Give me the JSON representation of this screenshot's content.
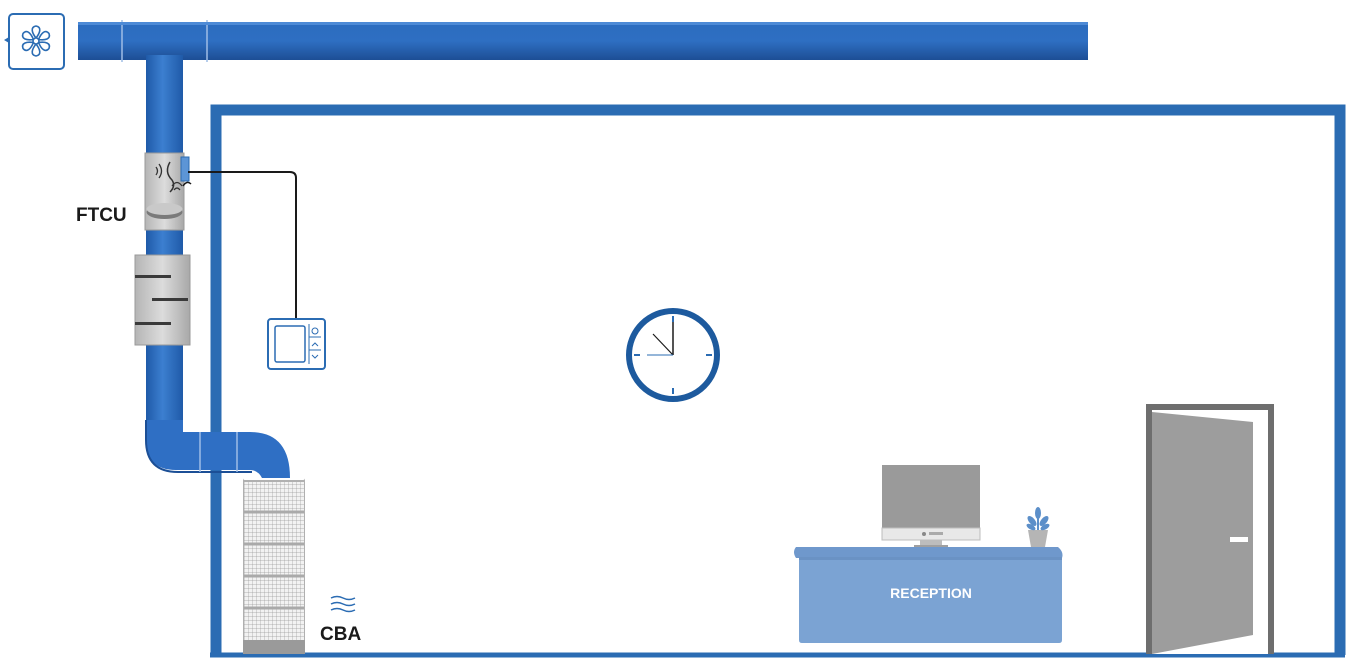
{
  "labels": {
    "ftcu": "FTCU",
    "cba": "CBA",
    "reception": "RECEPTION"
  },
  "icons": {
    "fan": "fan-icon",
    "clock": "clock-icon",
    "thermostat": "thermostat-icon",
    "airflow": "airflow-icon",
    "plant": "plant-icon",
    "monitor": "monitor-icon",
    "door": "door-icon"
  },
  "colors": {
    "duct_blue": "#2f6fc4",
    "duct_dark": "#1c4f96",
    "wall_blue": "#2b6cb3",
    "desk_blue": "#7ba3d3",
    "grey": "#9a9a9a",
    "dark_grey": "#6e6e6e"
  }
}
